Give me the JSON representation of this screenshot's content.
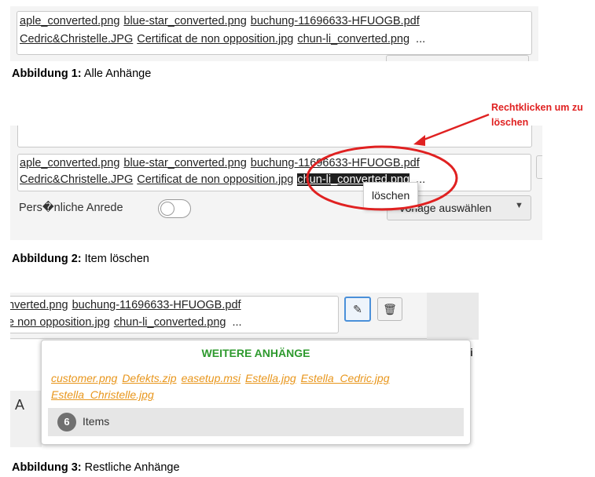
{
  "attachments_row1": [
    "aple_converted.png",
    "blue-star_converted.png",
    "buchung-11696633-HFUOGB.pdf"
  ],
  "attachments_row2": [
    "Cedric&Christelle.JPG",
    "Certificat de non opposition.jpg",
    "chun-li_converted.png"
  ],
  "more_marker": "...",
  "captions": {
    "fig1_label": "Abbildung 1:",
    "fig1_text": " Alle Anhänge",
    "fig2_label": "Abbildung 2:",
    "fig2_text": " Item löschen",
    "fig3_label": "Abbildung 3:",
    "fig3_text": " Restliche  Anhänge"
  },
  "fig2": {
    "anrede_label": "Pers�nliche Anrede",
    "context_menu_item": "löschen",
    "combo_label": "Vorlage auswählen",
    "highlight_label": "chun-li_converted.png",
    "annotation": "Rechtklicken um zu löschen",
    "annotation_color": "#e02121"
  },
  "fig3": {
    "row1": [
      "nverted.png",
      "buchung-11696633-HFUOGB.pdf"
    ],
    "row2": [
      "e non opposition.jpg",
      "chun-li_converted.png"
    ],
    "popup_title": "WEITERE ANHÄNGE",
    "popup_items": [
      "customer.png",
      "Defekts.zip",
      "easetup.msi",
      "Estella.jpg",
      "Estella_Cedric.jpg",
      "Estella_Christelle.jpg"
    ],
    "count": "6",
    "count_label": "Items",
    "toolbar_letter": "A",
    "paperclip_icon": "paperclip-icon",
    "trash_icon": "trash-icon"
  },
  "colors": {
    "popup_title": "#2e9a2e",
    "popup_items": "#e8961c",
    "highlight": "#1e1e1e"
  }
}
